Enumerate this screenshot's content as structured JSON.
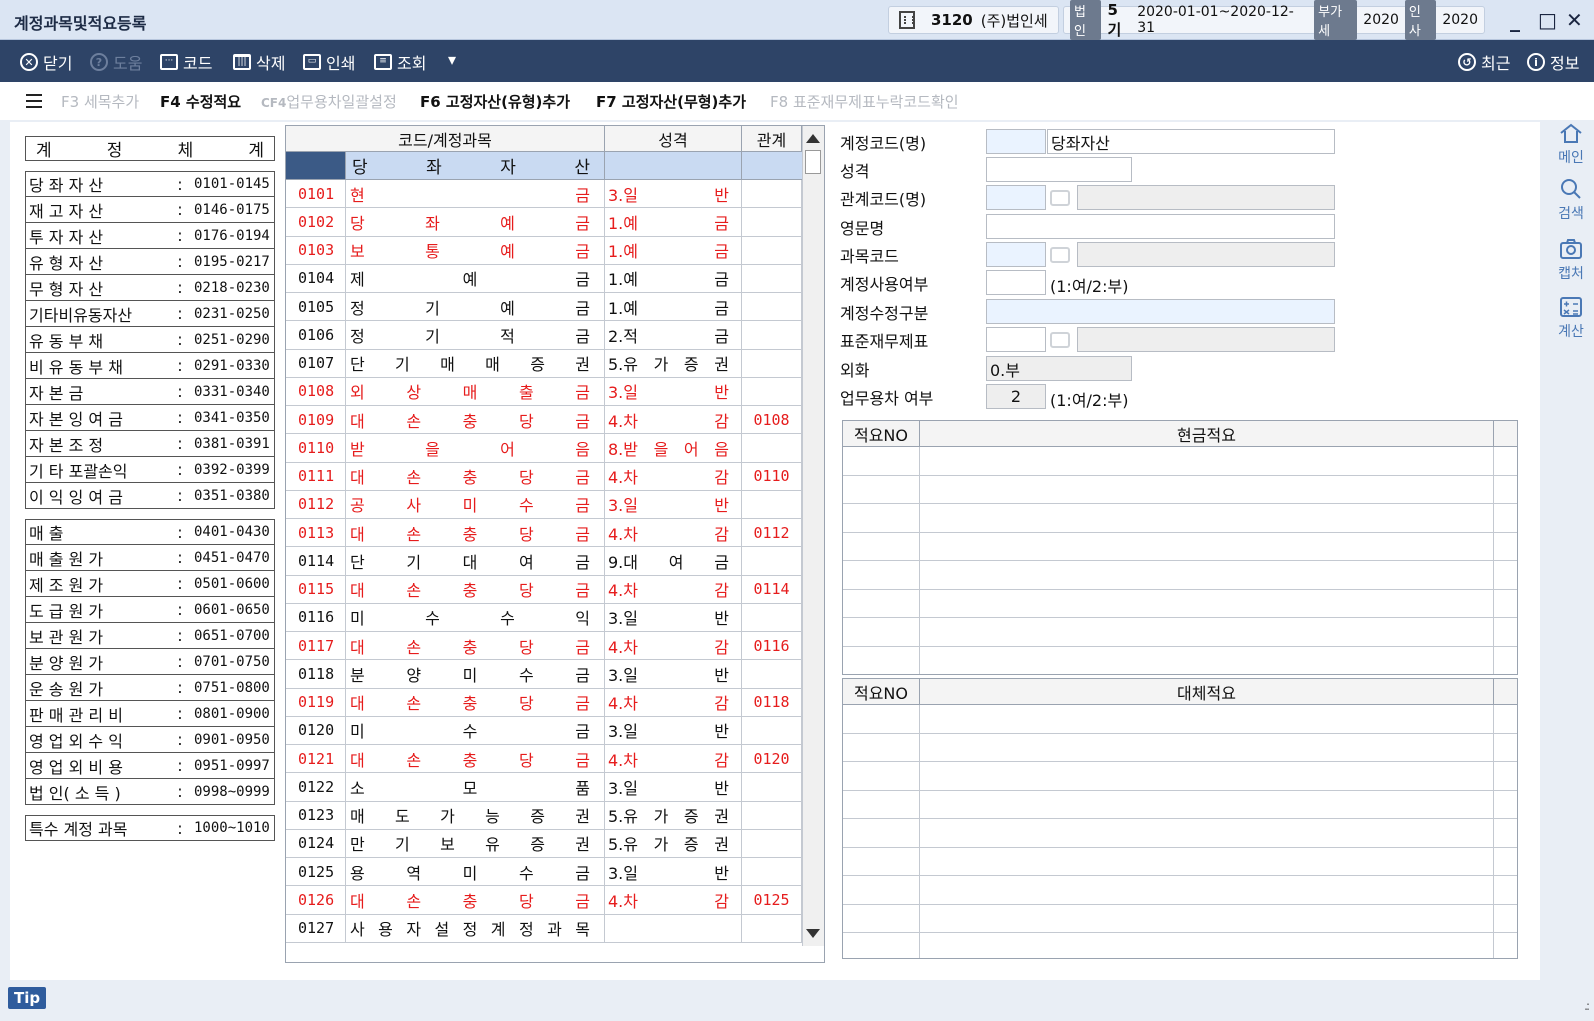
{
  "window": {
    "title": "계정과목및적요등록",
    "company_code": "3120",
    "company_name": "(주)법인세",
    "corp_tag": "법인",
    "term": "5기",
    "period": "2020-01-01~2020-12-31",
    "vat_tag": "부가세",
    "vat_year": "2020",
    "hr_tag": "인사",
    "hr_year": "2020",
    "minimize": "_",
    "maximize": "□",
    "close": "✕"
  },
  "toolbar": {
    "close_label": "닫기",
    "help_label": "도움",
    "code_label": "코드",
    "delete_label": "삭제",
    "print_label": "인쇄",
    "view_label": "조회",
    "dropdown": "▾",
    "recent_label": "최근",
    "info_label": "정보"
  },
  "fkeys": {
    "f3": "F3 세목추가",
    "f4": "F4 수정적요",
    "cf4_key": "CF4",
    "cf4_label": "업무용차일괄설정",
    "f6": "F6 고정자산(유형)추가",
    "f7": "F7 고정자산(무형)추가",
    "f8": "F8 표준재무제표누락코드확인"
  },
  "ref": {
    "header": [
      "계",
      "정",
      "체",
      "계"
    ],
    "groups": [
      [
        {
          "name": "당 좌 자 산",
          "range": "0101-0145"
        },
        {
          "name": "재 고 자 산",
          "range": "0146-0175"
        },
        {
          "name": "투 자 자 산",
          "range": "0176-0194"
        },
        {
          "name": "유 형 자 산",
          "range": "0195-0217"
        },
        {
          "name": "무 형 자 산",
          "range": "0218-0230"
        },
        {
          "name": "기타비유동자산",
          "range": "0231-0250"
        },
        {
          "name": "유 동 부 채",
          "range": "0251-0290"
        },
        {
          "name": "비 유 동 부 채",
          "range": "0291-0330"
        },
        {
          "name": "자  본  금",
          "range": "0331-0340"
        },
        {
          "name": "자 본 잉 여 금",
          "range": "0341-0350"
        },
        {
          "name": "자 본 조 정",
          "range": "0381-0391"
        },
        {
          "name": "기 타 포괄손익",
          "range": "0392-0399"
        },
        {
          "name": "이 익 잉 여 금",
          "range": "0351-0380"
        }
      ],
      [
        {
          "name": "매       출",
          "range": "0401-0430"
        },
        {
          "name": "매 출 원 가",
          "range": "0451-0470"
        },
        {
          "name": "제 조 원 가",
          "range": "0501-0600"
        },
        {
          "name": "도 급 원 가",
          "range": "0601-0650"
        },
        {
          "name": "보 관 원 가",
          "range": "0651-0700"
        },
        {
          "name": "분 양 원 가",
          "range": "0701-0750"
        },
        {
          "name": "운 송 원 가",
          "range": "0751-0800"
        },
        {
          "name": "판 매 관 리 비",
          "range": "0801-0900"
        },
        {
          "name": "영 업 외 수 익",
          "range": "0901-0950"
        },
        {
          "name": "영 업 외 비 용",
          "range": "0951-0997"
        },
        {
          "name": "법 인( 소 득 )",
          "range": "0998~0999"
        }
      ],
      [
        {
          "name": "특수 계정 과목",
          "range": "1000~1010"
        }
      ]
    ],
    "colon": ":"
  },
  "grid": {
    "headers": {
      "code_account": "코드/계정과목",
      "nature": "성격",
      "relation": "관계"
    },
    "section": [
      "당",
      "좌",
      "자",
      "산"
    ],
    "rows": [
      {
        "code": "0101",
        "name": [
          "현",
          "금"
        ],
        "nature": [
          "3.일",
          "반"
        ],
        "rel": "",
        "red": true
      },
      {
        "code": "0102",
        "name": [
          "당",
          "좌",
          "예",
          "금"
        ],
        "nature": [
          "1.예",
          "금"
        ],
        "rel": "",
        "red": true
      },
      {
        "code": "0103",
        "name": [
          "보",
          "통",
          "예",
          "금"
        ],
        "nature": [
          "1.예",
          "금"
        ],
        "rel": "",
        "red": true
      },
      {
        "code": "0104",
        "name": [
          "제",
          "예",
          "금"
        ],
        "nature": [
          "1.예",
          "금"
        ],
        "rel": "",
        "red": false
      },
      {
        "code": "0105",
        "name": [
          "정",
          "기",
          "예",
          "금"
        ],
        "nature": [
          "1.예",
          "금"
        ],
        "rel": "",
        "red": false
      },
      {
        "code": "0106",
        "name": [
          "정",
          "기",
          "적",
          "금"
        ],
        "nature": [
          "2.적",
          "금"
        ],
        "rel": "",
        "red": false
      },
      {
        "code": "0107",
        "name": [
          "단",
          "기",
          "매",
          "매",
          "증",
          "권"
        ],
        "nature": [
          "5.유",
          "가",
          "증",
          "권"
        ],
        "rel": "",
        "red": false
      },
      {
        "code": "0108",
        "name": [
          "외",
          "상",
          "매",
          "출",
          "금"
        ],
        "nature": [
          "3.일",
          "반"
        ],
        "rel": "",
        "red": true
      },
      {
        "code": "0109",
        "name": [
          "대",
          "손",
          "충",
          "당",
          "금"
        ],
        "nature": [
          "4.차",
          "감"
        ],
        "rel": "0108",
        "red": true
      },
      {
        "code": "0110",
        "name": [
          "받",
          "을",
          "어",
          "음"
        ],
        "nature": [
          "8.받",
          "을",
          "어",
          "음"
        ],
        "rel": "",
        "red": true
      },
      {
        "code": "0111",
        "name": [
          "대",
          "손",
          "충",
          "당",
          "금"
        ],
        "nature": [
          "4.차",
          "감"
        ],
        "rel": "0110",
        "red": true
      },
      {
        "code": "0112",
        "name": [
          "공",
          "사",
          "미",
          "수",
          "금"
        ],
        "nature": [
          "3.일",
          "반"
        ],
        "rel": "",
        "red": true
      },
      {
        "code": "0113",
        "name": [
          "대",
          "손",
          "충",
          "당",
          "금"
        ],
        "nature": [
          "4.차",
          "감"
        ],
        "rel": "0112",
        "red": true
      },
      {
        "code": "0114",
        "name": [
          "단",
          "기",
          "대",
          "여",
          "금"
        ],
        "nature": [
          "9.대",
          "여",
          "금"
        ],
        "rel": "",
        "red": false
      },
      {
        "code": "0115",
        "name": [
          "대",
          "손",
          "충",
          "당",
          "금"
        ],
        "nature": [
          "4.차",
          "감"
        ],
        "rel": "0114",
        "red": true
      },
      {
        "code": "0116",
        "name": [
          "미",
          "수",
          "수",
          "익"
        ],
        "nature": [
          "3.일",
          "반"
        ],
        "rel": "",
        "red": false
      },
      {
        "code": "0117",
        "name": [
          "대",
          "손",
          "충",
          "당",
          "금"
        ],
        "nature": [
          "4.차",
          "감"
        ],
        "rel": "0116",
        "red": true
      },
      {
        "code": "0118",
        "name": [
          "분",
          "양",
          "미",
          "수",
          "금"
        ],
        "nature": [
          "3.일",
          "반"
        ],
        "rel": "",
        "red": false
      },
      {
        "code": "0119",
        "name": [
          "대",
          "손",
          "충",
          "당",
          "금"
        ],
        "nature": [
          "4.차",
          "감"
        ],
        "rel": "0118",
        "red": true
      },
      {
        "code": "0120",
        "name": [
          "미",
          "수",
          "금"
        ],
        "nature": [
          "3.일",
          "반"
        ],
        "rel": "",
        "red": false
      },
      {
        "code": "0121",
        "name": [
          "대",
          "손",
          "충",
          "당",
          "금"
        ],
        "nature": [
          "4.차",
          "감"
        ],
        "rel": "0120",
        "red": true
      },
      {
        "code": "0122",
        "name": [
          "소",
          "모",
          "품"
        ],
        "nature": [
          "3.일",
          "반"
        ],
        "rel": "",
        "red": false
      },
      {
        "code": "0123",
        "name": [
          "매",
          "도",
          "가",
          "능",
          "증",
          "권"
        ],
        "nature": [
          "5.유",
          "가",
          "증",
          "권"
        ],
        "rel": "",
        "red": false
      },
      {
        "code": "0124",
        "name": [
          "만",
          "기",
          "보",
          "유",
          "증",
          "권"
        ],
        "nature": [
          "5.유",
          "가",
          "증",
          "권"
        ],
        "rel": "",
        "red": false
      },
      {
        "code": "0125",
        "name": [
          "용",
          "역",
          "미",
          "수",
          "금"
        ],
        "nature": [
          "3.일",
          "반"
        ],
        "rel": "",
        "red": false
      },
      {
        "code": "0126",
        "name": [
          "대",
          "손",
          "충",
          "당",
          "금"
        ],
        "nature": [
          "4.차",
          "감"
        ],
        "rel": "0125",
        "red": true
      },
      {
        "code": "0127",
        "name": [
          "사",
          "용",
          "자",
          "설",
          "정",
          "계",
          "정",
          "과",
          "목"
        ],
        "nature": [],
        "rel": "",
        "red": false
      }
    ]
  },
  "form": {
    "account_code_label": "계정코드(명)",
    "account_code_value": "",
    "account_name_value": "당좌자산",
    "nature_label": "성격",
    "nature_value": "",
    "relation_label": "관계코드(명)",
    "english_label": "영문명",
    "subject_label": "과목코드",
    "usage_label": "계정사용여부",
    "usage_hint": "(1:여/2:부)",
    "modify_label": "계정수정구분",
    "std_fs_label": "표준재무제표",
    "forex_label": "외화",
    "forex_value": "0.부",
    "biz_car_label": "업무용차 여부",
    "biz_car_value": "2",
    "biz_car_hint": "(1:여/2:부)"
  },
  "memo_cash": {
    "no_label": "적요NO",
    "title": "현금적요"
  },
  "memo_alt": {
    "no_label": "적요NO",
    "title": "대체적요"
  },
  "sidenav": {
    "main": "메인",
    "search": "검색",
    "capture": "캡처",
    "calc": "계산"
  },
  "status": {
    "tip": "Tip",
    "grip": ".:"
  }
}
